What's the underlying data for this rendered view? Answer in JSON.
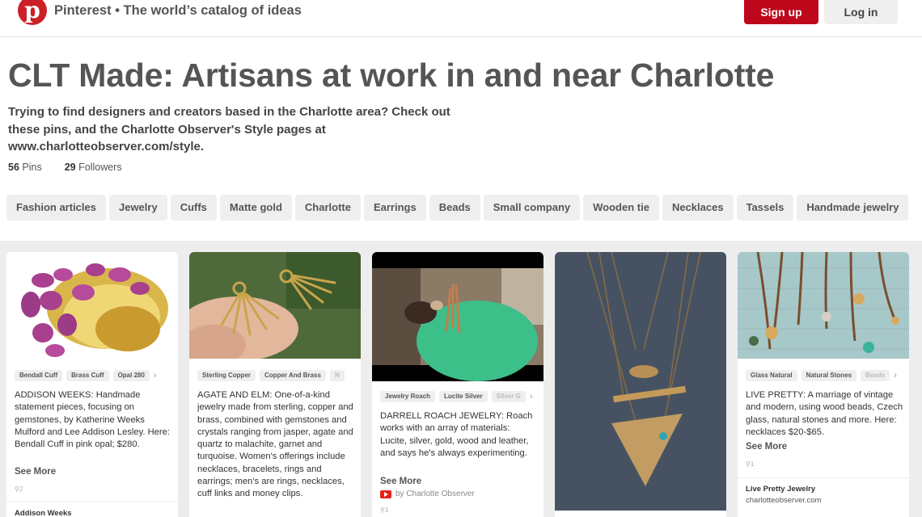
{
  "header": {
    "logo_glyph": "p",
    "tagline": "Pinterest • The world’s catalog of ideas",
    "signup_label": "Sign up",
    "login_label": "Log in",
    "brand_color": "#bd081c"
  },
  "board": {
    "title": "CLT Made: Artisans at work in and near Charlotte",
    "description": "Trying to find designers and creators based in the Charlotte area? Check out these pins, and the Charlotte Observer's Style pages at www.charlotteobserver.com/style.",
    "pins_count": "56",
    "pins_label": "Pins",
    "followers_count": "29",
    "followers_label": "Followers"
  },
  "filters": [
    "Fashion articles",
    "Jewelry",
    "Cuffs",
    "Matte gold",
    "Charlotte",
    "Earrings",
    "Beads",
    "Small company",
    "Wooden tie",
    "Necklaces",
    "Tassels",
    "Handmade jewelry"
  ],
  "pins": [
    {
      "tags": [
        "Bendall Cuff",
        "Brass Cuff",
        "Opal 280"
      ],
      "description": "ADDISON WEEKS: Handmade statement pieces, focusing on gemstones, by Katherine Weeks Mulford and Lee Addison Lesley. Here: Bendall Cuff in pink opal; $280.",
      "see_more": "See More",
      "repins": "⚲2",
      "source": "Addison Weeks"
    },
    {
      "tags": [
        "Sterling Copper",
        "Copper And Brass",
        "N"
      ],
      "description": "AGATE AND ELM: One-of-a-kind jewelry made from sterling, copper and brass, combined with gemstones and crystals ranging from jasper, agate and quartz to malachite, garnet and turquoise. Women's offerings include necklaces, bracelets, rings and earrings; men's are rings, necklaces, cuff links and money clips."
    },
    {
      "tags": [
        "Jewelry Roach",
        "Lucite Silver",
        "Silver G"
      ],
      "description": "DARRELL ROACH JEWELRY: Roach works with an array of materials: Lucite, silver, gold, wood and leather, and says he's always experimenting.",
      "see_more": "See More",
      "via": "by Charlotte Observer",
      "repins": "⚲1"
    },
    {},
    {
      "tags": [
        "Glass Natural",
        "Natural Stones",
        "Beads"
      ],
      "description": "LIVE PRETTY: A marriage of vintage and modern, using wood beads, Czech glass, natural stones and more. Here: necklaces $20-$65.",
      "see_more": "See More",
      "repins": "⚲1",
      "source": "Live Pretty Jewelry",
      "source_domain": "charlotteobserver.com"
    }
  ]
}
